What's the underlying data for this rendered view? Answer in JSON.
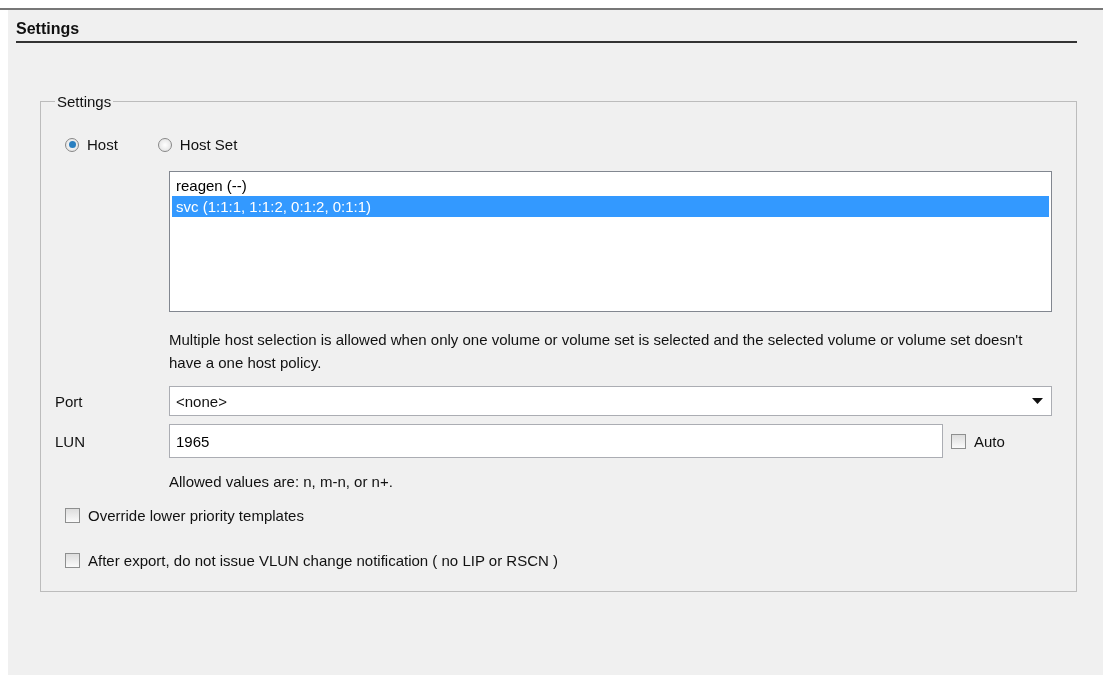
{
  "header": {
    "title": "Settings"
  },
  "group": {
    "legend": "Settings",
    "target_options": [
      {
        "label": "Host",
        "selected": true
      },
      {
        "label": "Host Set",
        "selected": false
      }
    ],
    "hosts": [
      {
        "label": "reagen (--)",
        "selected": false
      },
      {
        "label": "svc (1:1:1, 1:1:2, 0:1:2, 0:1:1)",
        "selected": true
      }
    ],
    "host_note": "Multiple host selection is allowed when only one volume or volume set is selected and the selected volume or volume set doesn't have a one host policy.",
    "port": {
      "label": "Port",
      "value": "<none>"
    },
    "lun": {
      "label": "LUN",
      "value": "1965",
      "auto": {
        "label": "Auto",
        "checked": false
      },
      "note": "Allowed values are: n, m-n, or n+."
    },
    "options": [
      {
        "label": "Override lower priority templates",
        "checked": false
      },
      {
        "label": "After export, do not issue VLUN change notification ( no LIP or RSCN )",
        "checked": false
      }
    ]
  }
}
